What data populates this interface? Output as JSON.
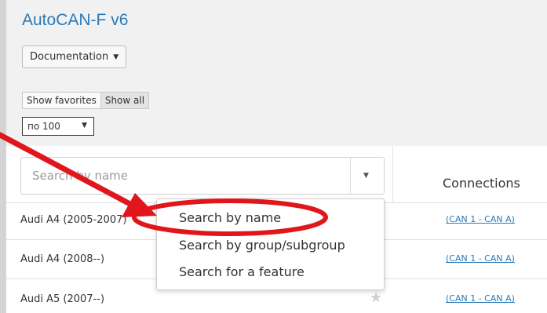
{
  "app": {
    "title": "AutoCAN-F v6"
  },
  "toolbar": {
    "documentation_label": "Documentation"
  },
  "filters": {
    "favorites_label": "Show favorites",
    "all_label": "Show all",
    "page_size": "по 100"
  },
  "search": {
    "placeholder": "Search by name",
    "options": [
      "Search by name",
      "Search by group/subgroup",
      "Search for a feature"
    ]
  },
  "table": {
    "connections_header": "Connections",
    "rows": [
      {
        "name": "Audi A4 (2005-2007)",
        "connection": "(CAN 1 - CAN A)"
      },
      {
        "name": "Audi A4 (2008--)",
        "connection": "(CAN 1 - CAN A)"
      },
      {
        "name": "Audi A5 (2007--)",
        "connection": "(CAN 1 - CAN A)"
      }
    ]
  },
  "colors": {
    "accent": "#2a7ab8",
    "annotation": "#e0161c"
  }
}
